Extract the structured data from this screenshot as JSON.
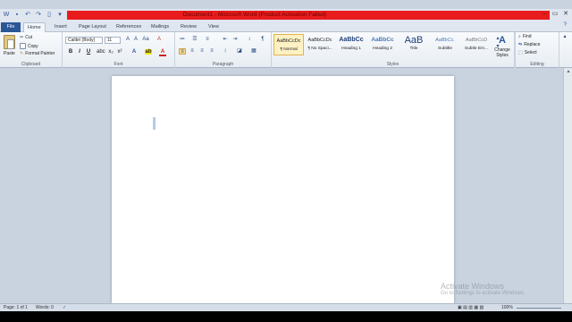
{
  "window": {
    "title": "Document1 - Microsoft Word (Product Activation Failed)",
    "title_bar_highlight": "#e81c1c",
    "controls": [
      "minimize-icon",
      "restore-icon",
      "close-icon"
    ]
  },
  "quick_access": [
    "word-logo-icon",
    "save-icon",
    "undo-icon",
    "redo-icon",
    "new-doc-icon",
    "customize-icon"
  ],
  "tabs": [
    {
      "label": "File"
    },
    {
      "label": "Home"
    },
    {
      "label": "Insert"
    },
    {
      "label": "Page Layout"
    },
    {
      "label": "References"
    },
    {
      "label": "Mailings"
    },
    {
      "label": "Review"
    },
    {
      "label": "View"
    }
  ],
  "ribbon": {
    "clipboard": {
      "label": "Clipboard",
      "paste": "Paste",
      "cut": "Cut",
      "copy": "Copy",
      "format_painter": "Format Painter"
    },
    "font": {
      "label": "Font",
      "font_name": "Calibri (Body)",
      "font_size": "11",
      "bold": "B",
      "italic": "I",
      "underline": "U"
    },
    "paragraph": {
      "label": "Paragraph"
    },
    "styles": {
      "label": "Styles",
      "items": [
        {
          "sample": "AaBbCcDc",
          "name": "¶ Normal"
        },
        {
          "sample": "AaBbCcDc",
          "name": "¶ No Spaci..."
        },
        {
          "sample": "AaBbCc",
          "name": "Heading 1"
        },
        {
          "sample": "AaBbCc",
          "name": "Heading 2"
        },
        {
          "sample": "AaB",
          "name": "Title"
        },
        {
          "sample": "AaBbCc.",
          "name": "Subtitle"
        },
        {
          "sample": "AaBbCcD",
          "name": "Subtle Em..."
        }
      ],
      "change_styles": "Change Styles"
    },
    "editing": {
      "label": "Editing",
      "find": "Find",
      "replace": "Replace",
      "select": "Select"
    }
  },
  "watermark": {
    "line1": "Activate Windows",
    "line2": "Go to Settings to activate Windows."
  },
  "status": {
    "page": "Page: 1 of 1",
    "words": "Words: 0",
    "zoom": "100%"
  }
}
